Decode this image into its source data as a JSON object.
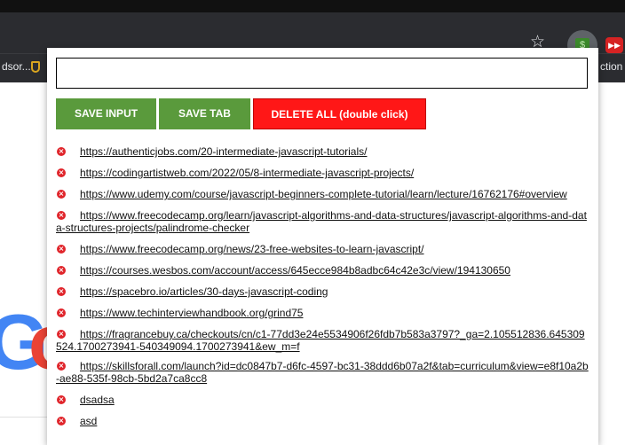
{
  "browser": {
    "bookmark_left": "dsor....",
    "bookmark_right": "ction to",
    "star_icon": "star-icon",
    "extension_icon_text": "$",
    "red_extension_icon": "▶▶"
  },
  "background_page": {
    "logo_letter_1": "G",
    "logo_letter_2": "o"
  },
  "popup": {
    "input": {
      "value": "",
      "placeholder": ""
    },
    "buttons": {
      "save_input": "SAVE INPUT",
      "save_tab": "SAVE TAB",
      "delete_all": "DELETE ALL (double click)"
    },
    "delete_icon_glyph": "×",
    "items": [
      "https://authenticjobs.com/20-intermediate-javascript-tutorials/",
      "https://codingartistweb.com/2022/05/8-intermediate-javascript-projects/",
      "https://www.udemy.com/course/javascript-beginners-complete-tutorial/learn/lecture/16762176#overview",
      "https://www.freecodecamp.org/learn/javascript-algorithms-and-data-structures/javascript-algorithms-and-data-structures-projects/palindrome-checker",
      "https://www.freecodecamp.org/news/23-free-websites-to-learn-javascript/",
      "https://courses.wesbos.com/account/access/645ecce984b8adbc64c42e3c/view/194130650",
      "https://spacebro.io/articles/30-days-javascript-coding",
      "https://www.techinterviewhandbook.org/grind75",
      "https://fragrancebuy.ca/checkouts/cn/c1-77dd3e24e5534906f26fdb7b583a3797?_ga=2.105512836.645309524.1700273941-540349094.1700273941&ew_m=f",
      "https://skillsforall.com/launch?id=dc0847b7-d6fc-4597-bc31-38ddd6b07a2f&tab=curriculum&view=e8f10a2b-ae88-535f-98cb-5bd2a7ca8cc8",
      "dsadsa",
      "asd"
    ]
  }
}
